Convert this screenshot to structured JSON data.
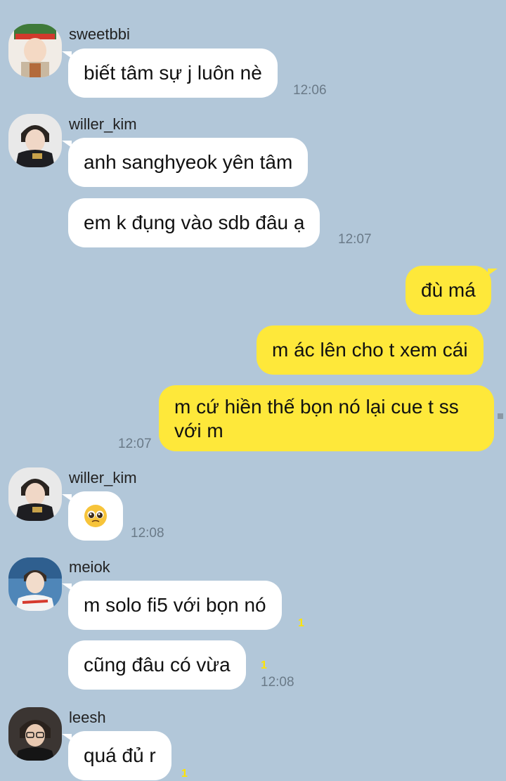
{
  "messages": {
    "m1_sender": "sweetbbi",
    "m1_text": "biết tâm sự j luôn nè",
    "m1_time": "12:06",
    "m2_sender": "willer_kim",
    "m2_text1": "anh sanghyeok yên tâm",
    "m2_text2": "em k đụng vào sdb đâu ạ",
    "m2_time": "12:07",
    "me_text1": "đù má",
    "me_text2": "m ác lên cho t xem cái",
    "me_text3": "m cứ hiền thế bọn nó lại cue t ss với m",
    "me_time": "12:07",
    "m3_sender": "willer_kim",
    "m3_time": "12:08",
    "m4_sender": "meiok",
    "m4_text1": "m solo fi5 với bọn nó",
    "m4_unread1": "1",
    "m4_text2": "cũng đâu có vừa",
    "m4_unread2": "1",
    "m4_time": "12:08",
    "m5_sender": "leesh",
    "m5_text": "quá đủ r",
    "m5_unread": "1"
  },
  "colors": {
    "background": "#b2c7d9",
    "bubble_other": "#ffffff",
    "bubble_mine": "#fee83a",
    "unread": "#ffe400",
    "time": "#6a7a88"
  },
  "icons": {
    "emoji": "pleading-face-emoji"
  }
}
